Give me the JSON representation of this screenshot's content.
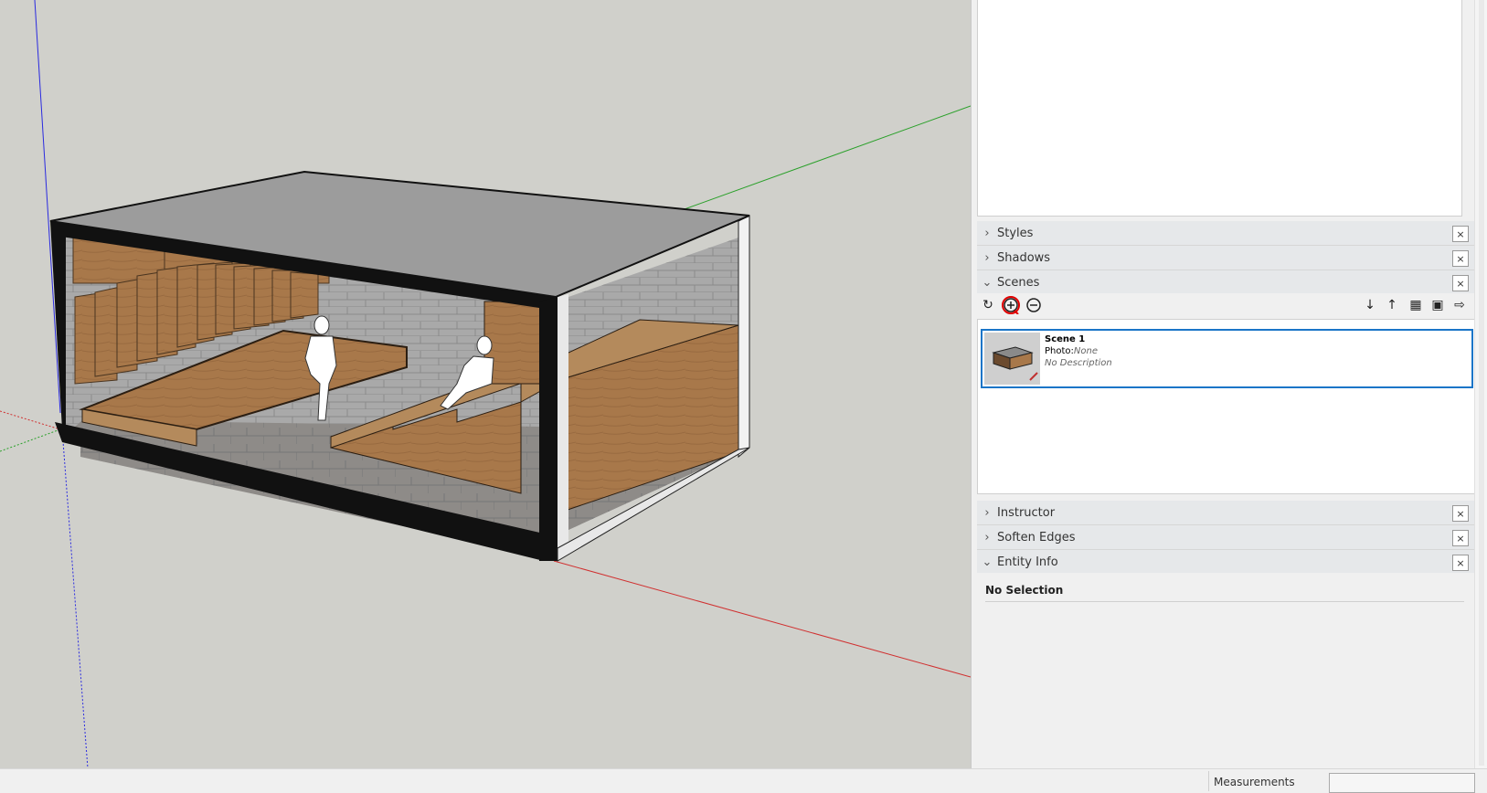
{
  "tray": {
    "panels": [
      {
        "title": "Styles",
        "expanded": false
      },
      {
        "title": "Shadows",
        "expanded": false
      },
      {
        "title": "Scenes",
        "expanded": true
      },
      {
        "title": "Instructor",
        "expanded": false
      },
      {
        "title": "Soften Edges",
        "expanded": false
      },
      {
        "title": "Entity Info",
        "expanded": true
      }
    ],
    "close_glyph": "×"
  },
  "scenes": {
    "toolbar_icons": [
      "refresh-icon",
      "add-scene-icon",
      "remove-scene-icon",
      "move-down-icon",
      "move-up-icon",
      "view-options-icon",
      "scene-details-icon",
      "export-icon"
    ],
    "items": [
      {
        "name": "Scene 1",
        "photo_label": "Photo:",
        "photo_value": "None",
        "description": "No Description"
      }
    ]
  },
  "entity_info": {
    "status": "No Selection"
  },
  "statusbar": {
    "measurements_label": "Measurements",
    "measurements_value": ""
  },
  "colors": {
    "selection": "#1a75c8",
    "axis_red": "#d03030",
    "axis_green": "#2aa02a",
    "axis_blue": "#2a2ae0",
    "annotation": "#e00000"
  }
}
